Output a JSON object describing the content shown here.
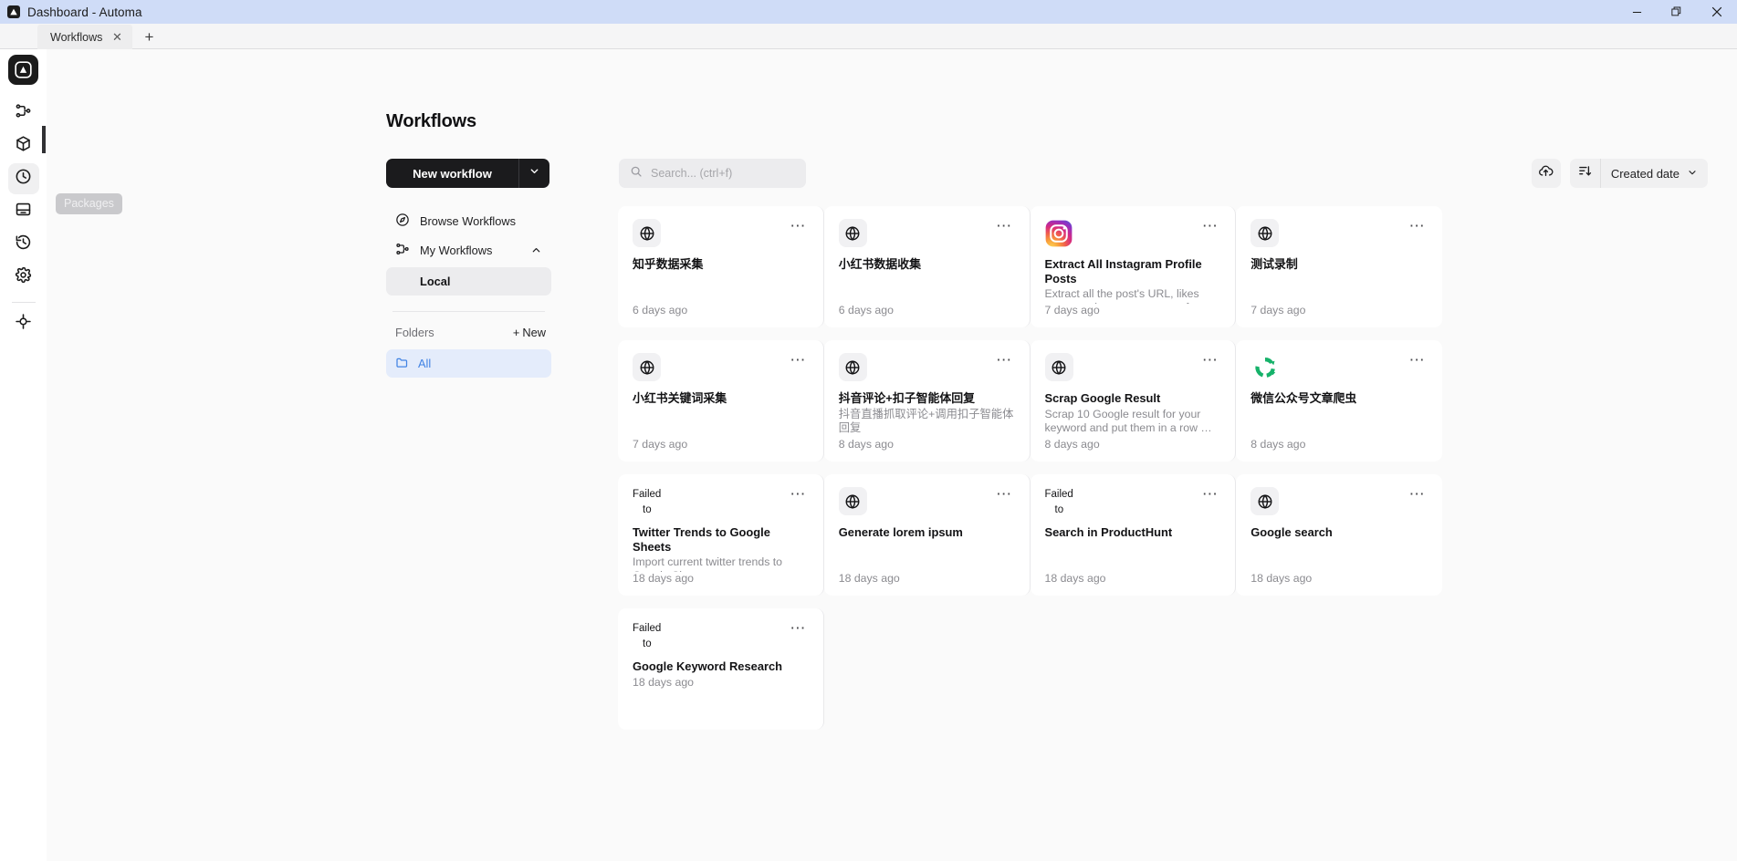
{
  "window": {
    "title": "Dashboard - Automa",
    "controls": {
      "minimize": "minimize-icon",
      "restore": "restore-icon",
      "close": "close-icon"
    }
  },
  "tabs": {
    "items": [
      {
        "label": "Workflows",
        "active": true
      }
    ],
    "new_tab_label": "+"
  },
  "rail": {
    "logo": "automa-logo-icon",
    "tooltip": "Packages",
    "items": [
      {
        "name": "workflows",
        "icon": "workflow-icon",
        "active": false
      },
      {
        "name": "packages",
        "icon": "package-icon",
        "active": false
      },
      {
        "name": "scheduler",
        "icon": "clock-icon",
        "active": true
      },
      {
        "name": "storage",
        "icon": "storage-icon",
        "active": false
      },
      {
        "name": "logs",
        "icon": "history-icon",
        "active": false
      },
      {
        "name": "settings",
        "icon": "gear-icon",
        "active": false
      },
      {
        "name": "recorder",
        "icon": "target-icon",
        "active": false
      }
    ]
  },
  "header": {
    "title": "Workflows"
  },
  "toolbar": {
    "new_workflow_label": "New workflow",
    "new_workflow_caret": "chevron-down-icon",
    "search_placeholder": "Search... (ctrl+f)",
    "search_value": "",
    "search_icon": "search-icon",
    "cloud_icon": "cloud-upload-icon",
    "sort_icon": "sort-descending-icon",
    "sort_label": "Created date",
    "sort_caret": "chevron-down-icon"
  },
  "nav": {
    "browse_label": "Browse Workflows",
    "my_workflows_label": "My Workflows",
    "local_label": "Local",
    "folders_label": "Folders",
    "new_folder_label": "New",
    "all_folder_label": "All"
  },
  "cards": [
    {
      "title": "知乎数据采集",
      "desc": "",
      "time": "6 days ago",
      "icon": "globe-icon"
    },
    {
      "title": "小红书数据收集",
      "desc": "",
      "time": "6 days ago",
      "icon": "globe-icon"
    },
    {
      "title": "Extract All Instagram Profile Posts",
      "desc": "Extract all the post's URL, likes count, and comments count fro…",
      "time": "7 days ago",
      "icon": "instagram-icon"
    },
    {
      "title": "测试录制",
      "desc": "",
      "time": "7 days ago",
      "icon": "globe-icon"
    },
    {
      "title": "小红书关键词采集",
      "desc": "",
      "time": "7 days ago",
      "icon": "globe-icon"
    },
    {
      "title": "抖音评论+扣子智能体回复",
      "desc": "抖音直播抓取评论+调用扣子智能体回复",
      "time": "8 days ago",
      "icon": "globe-icon"
    },
    {
      "title": "Scrap Google Result",
      "desc": "Scrap 10 Google result for your keyword and put them in a row …",
      "time": "8 days ago",
      "icon": "globe-icon"
    },
    {
      "title": "微信公众号文章爬虫",
      "desc": "",
      "time": "8 days ago",
      "icon": "wechat-swirl-icon"
    },
    {
      "title": "Twitter Trends to Google Sheets",
      "desc": "Import current twitter trends to Google Sheets",
      "time": "18 days ago",
      "icon": "broken-image-icon",
      "icon_alt": [
        "Failed",
        "to"
      ]
    },
    {
      "title": "Generate lorem ipsum",
      "desc": "",
      "time": "18 days ago",
      "icon": "globe-icon"
    },
    {
      "title": "Search in ProductHunt",
      "desc": "",
      "time": "18 days ago",
      "icon": "broken-image-icon",
      "icon_alt": [
        "Failed",
        "to"
      ]
    },
    {
      "title": "Google search",
      "desc": "",
      "time": "18 days ago",
      "icon": "globe-icon"
    },
    {
      "title": "Google Keyword Research",
      "desc": "",
      "time": "18 days ago",
      "icon": "broken-image-icon",
      "icon_alt": [
        "Failed",
        "to"
      ],
      "compact": true
    }
  ],
  "card_menu_glyph": "⋯",
  "colors": {
    "titlebar": "#cfdcf7",
    "accent_dark": "#1b1b1d",
    "folder_blue": "#4183e4",
    "folder_blue_bg": "#e4ecfb",
    "wechat_green": "#16b26a",
    "page_bg": "#fafafa"
  }
}
